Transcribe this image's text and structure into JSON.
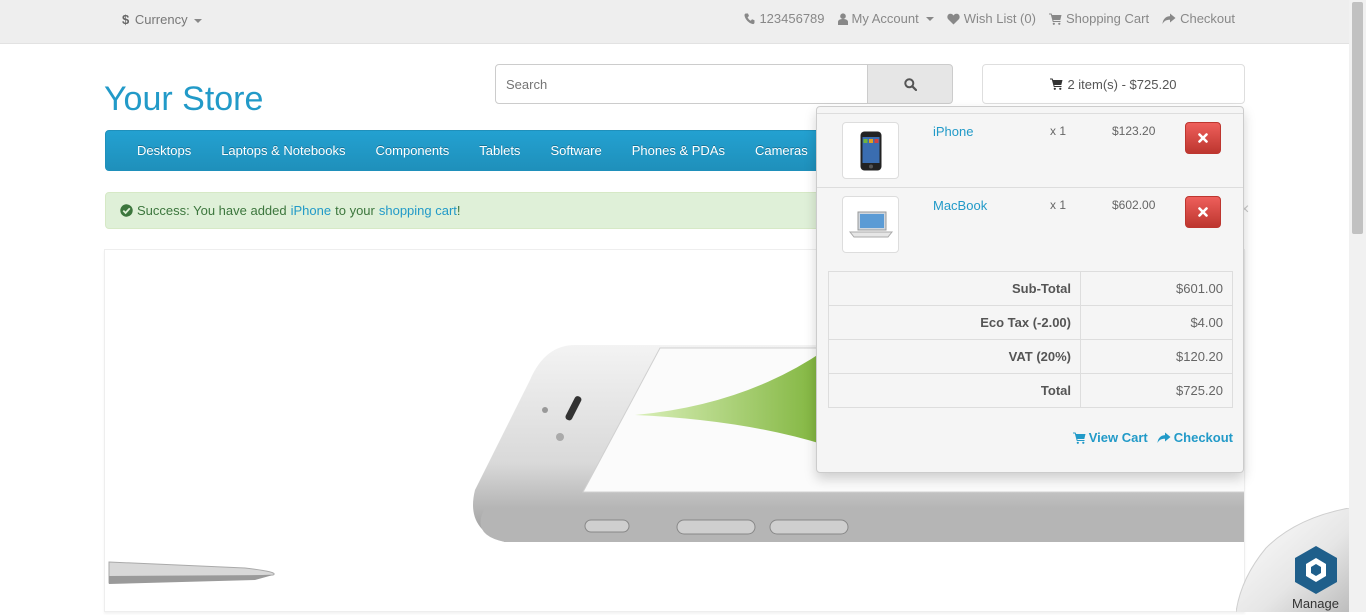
{
  "topbar": {
    "currency_symbol": "$",
    "currency_label": "Currency",
    "phone": "123456789",
    "my_account": "My Account",
    "wish_list": "Wish List (0)",
    "shopping_cart": "Shopping Cart",
    "checkout": "Checkout"
  },
  "header": {
    "logo": "Your Store",
    "search_placeholder": "Search",
    "cart_summary": "2 item(s) - $725.20"
  },
  "menu": {
    "items": [
      "Desktops",
      "Laptops & Notebooks",
      "Components",
      "Tablets",
      "Software",
      "Phones & PDAs",
      "Cameras"
    ]
  },
  "alert": {
    "prefix": "Success: You have added",
    "product_link": "iPhone",
    "middle": "to your",
    "cart_link": "shopping cart",
    "suffix": "!"
  },
  "cart": {
    "items": [
      {
        "name": "iPhone",
        "qty": "x 1",
        "price": "$123.20"
      },
      {
        "name": "MacBook",
        "qty": "x 1",
        "price": "$602.00"
      }
    ],
    "totals": [
      {
        "label": "Sub-Total",
        "value": "$601.00"
      },
      {
        "label": "Eco Tax (-2.00)",
        "value": "$4.00"
      },
      {
        "label": "VAT (20%)",
        "value": "$120.20"
      },
      {
        "label": "Total",
        "value": "$725.20"
      }
    ],
    "view_cart": "View Cart",
    "checkout": "Checkout"
  },
  "widget": {
    "manage_label": "Manage"
  },
  "colors": {
    "brand_blue": "#229ac8",
    "success_bg": "#dff0d8",
    "danger": "#da4f49"
  },
  "icons": [
    "phone-icon",
    "user-icon",
    "heart-icon",
    "cart-icon",
    "share-icon",
    "search-icon",
    "check-circle-icon",
    "remove-icon"
  ]
}
